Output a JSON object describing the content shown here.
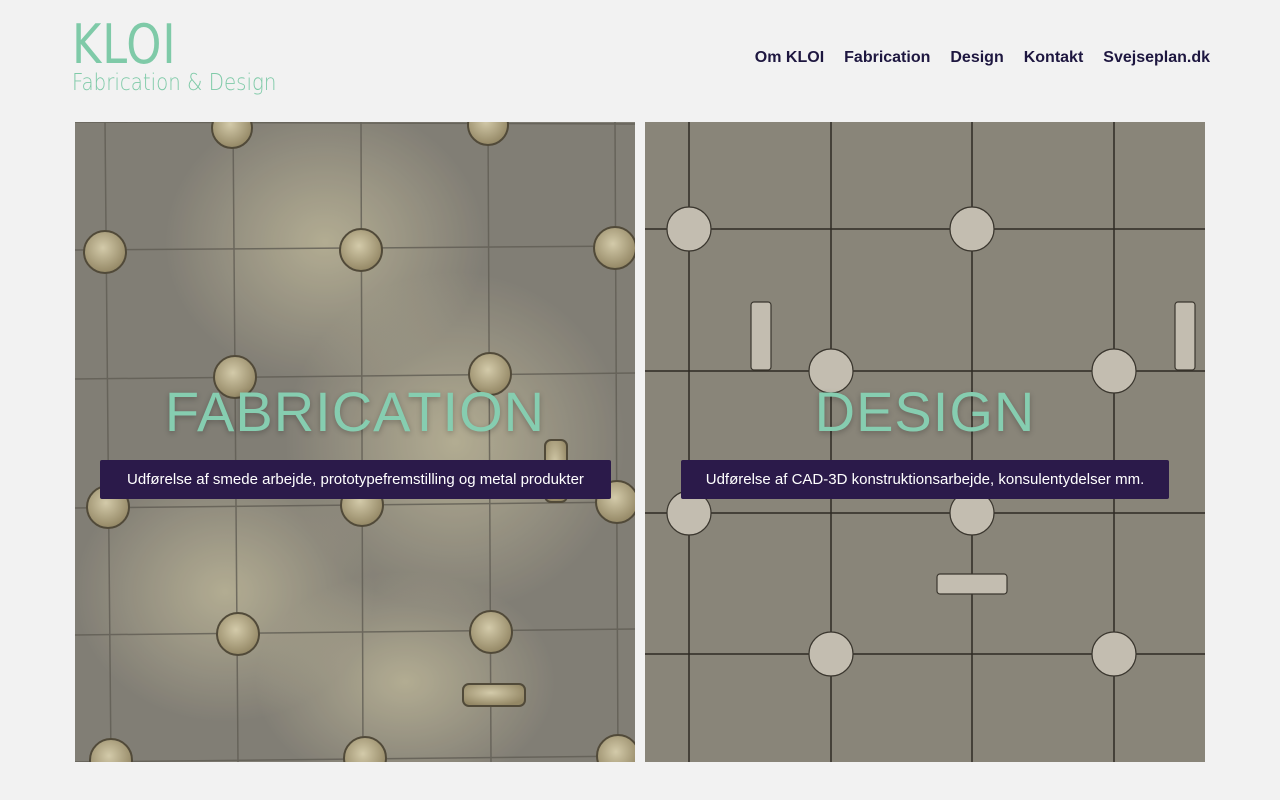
{
  "logo": {
    "name": "KLOI",
    "tagline": "Fabrication & Design",
    "color": "#7fcaa8"
  },
  "nav": {
    "items": [
      {
        "label": "Om KLOI"
      },
      {
        "label": "Fabrication"
      },
      {
        "label": "Design"
      },
      {
        "label": "Kontakt"
      },
      {
        "label": "Svejseplan.dk"
      }
    ],
    "color": "#1e1740"
  },
  "panels": [
    {
      "title": "FABRICATION",
      "caption": "Udførelse af smede arbejde, prototypefremstilling og metal produkter",
      "image": "welding-table-photo"
    },
    {
      "title": "DESIGN",
      "caption": "Udførelse af CAD-3D konstruktionsarbejde, konsulentydelser mm.",
      "image": "welding-table-drawing"
    }
  ],
  "colors": {
    "title": "#86cdb0",
    "caption_bg": "#2b1a4a",
    "background": "#f2f2f2"
  }
}
